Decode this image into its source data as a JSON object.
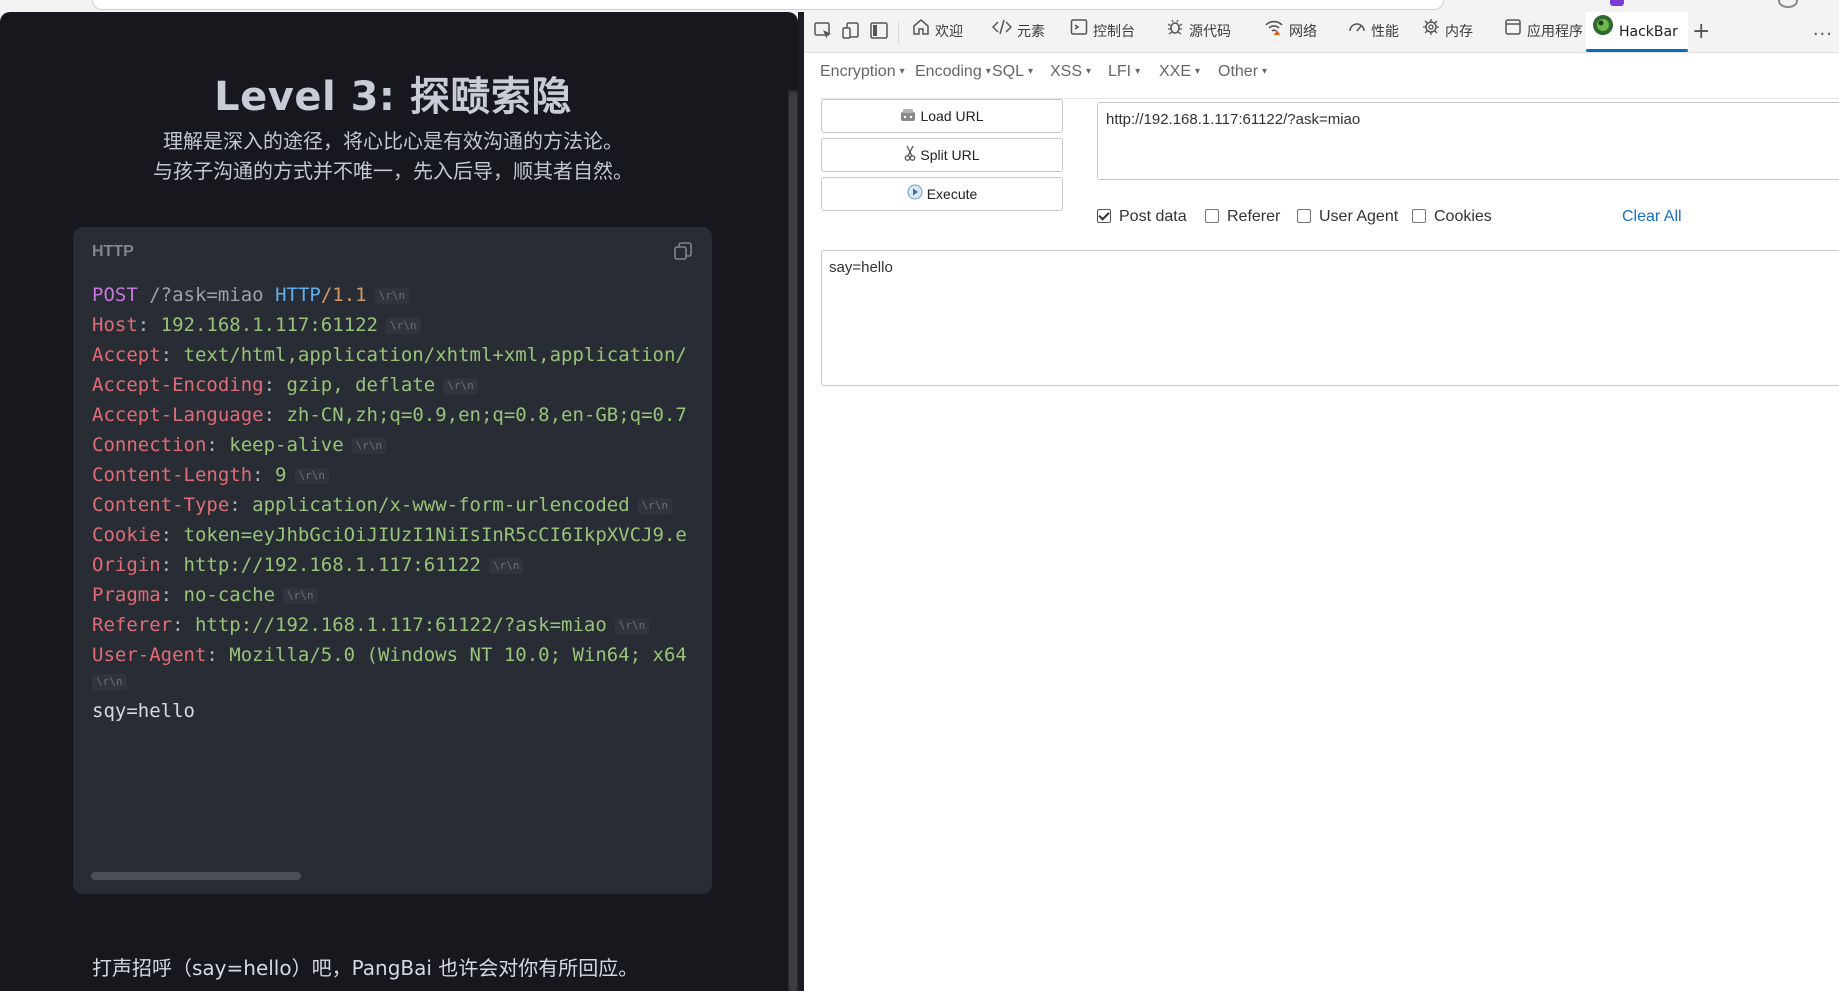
{
  "page": {
    "title": "Level 3: 探赜索隐",
    "subtitle_line1": "理解是深入的途径，将心比心是有效沟通的方法论。",
    "subtitle_line2": "与孩子沟通的方式并不唯一，先入后导，顺其者自然。",
    "code_lang": "HTTP",
    "crlf": "\\r\\n",
    "request": {
      "method": "POST",
      "path": "/?ask=miao",
      "protocol": "HTTP",
      "version": "/1.1",
      "headers": [
        {
          "name": "Host",
          "value": "192.168.1.117:61122",
          "crlf": true
        },
        {
          "name": "Accept",
          "value": "text/html,application/xhtml+xml,application/",
          "crlf": false
        },
        {
          "name": "Accept-Encoding",
          "value": "gzip, deflate",
          "crlf": true
        },
        {
          "name": "Accept-Language",
          "value": "zh-CN,zh;q=0.9,en;q=0.8,en-GB;q=0.7",
          "crlf": false
        },
        {
          "name": "Connection",
          "value": "keep-alive",
          "crlf": true
        },
        {
          "name": "Content-Length",
          "value": "9",
          "crlf": true
        },
        {
          "name": "Content-Type",
          "value": "application/x-www-form-urlencoded",
          "crlf": true
        },
        {
          "name": "Cookie",
          "value": "token=eyJhbGciOiJIUzI1NiIsInR5cCI6IkpXVCJ9.e",
          "crlf": false
        },
        {
          "name": "Origin",
          "value": "http://192.168.1.117:61122",
          "crlf": true
        },
        {
          "name": "Pragma",
          "value": "no-cache",
          "crlf": true
        },
        {
          "name": "Referer",
          "value": "http://192.168.1.117:61122/?ask=miao",
          "crlf": true
        },
        {
          "name": "User-Agent",
          "value": "Mozilla/5.0 (Windows NT 10.0; Win64; x64",
          "crlf": false
        }
      ],
      "body": "sqy=hello"
    },
    "bottom_note": "打声招呼（say=hello）吧，PangBai 也许会对你有所回应。"
  },
  "devtools": {
    "tabs": [
      {
        "label": "欢迎",
        "icon": "home-icon"
      },
      {
        "label": "元素",
        "icon": "code-icon"
      },
      {
        "label": "控制台",
        "icon": "console-icon"
      },
      {
        "label": "源代码",
        "icon": "bug-icon"
      },
      {
        "label": "网络",
        "icon": "wifi-icon"
      },
      {
        "label": "性能",
        "icon": "gauge-icon"
      },
      {
        "label": "内存",
        "icon": "chip-icon"
      },
      {
        "label": "应用程序",
        "icon": "app-icon"
      },
      {
        "label": "HackBar",
        "icon": "hackbar-logo-icon",
        "active": true
      }
    ],
    "more": "···"
  },
  "hackbar": {
    "menu": [
      "Encryption",
      "Encoding",
      "SQL",
      "XSS",
      "LFI",
      "XXE",
      "Other"
    ],
    "load_url": "Load URL",
    "split_url": "Split URL",
    "execute": "Execute",
    "url": "http://192.168.1.117:61122/?ask=miao",
    "options": {
      "post_data": "Post data",
      "referer": "Referer",
      "user_agent": "User Agent",
      "cookies": "Cookies"
    },
    "clear_all": "Clear All",
    "post_body": "say=hello"
  }
}
